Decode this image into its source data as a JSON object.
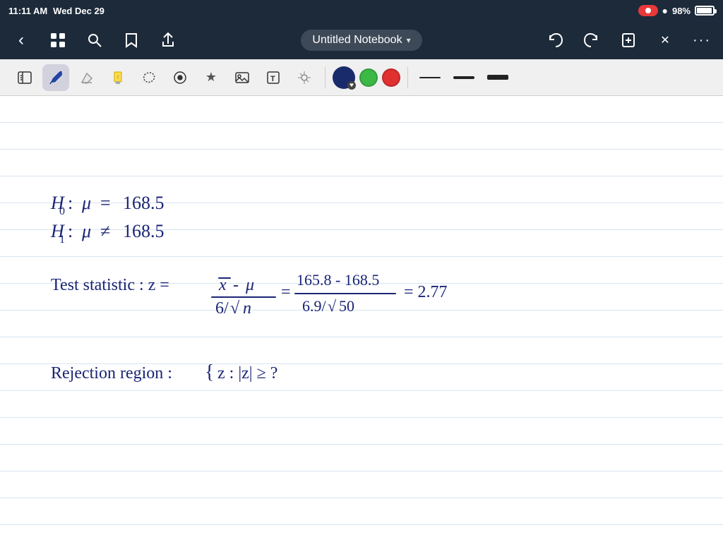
{
  "status_bar": {
    "time": "11:11 AM",
    "date": "Wed Dec 29",
    "battery_percent": "98%",
    "wifi": true,
    "recording": true
  },
  "nav_bar": {
    "back_label": "‹",
    "apps_icon": "⊞",
    "search_icon": "⌕",
    "bookmark_icon": "🔖",
    "share_icon": "↑",
    "title": "Untitled Notebook",
    "title_chevron": "▾",
    "undo_icon": "↩",
    "redo_icon": "↪",
    "add_page_icon": "☐",
    "close_icon": "✕",
    "more_icon": "···"
  },
  "toolbar": {
    "panel_icon": "▤",
    "pen_icon": "✏",
    "eraser_icon": "⬜",
    "highlighter_icon": "✒",
    "lasso_icon": "◎",
    "shape_icon": "◯",
    "star_icon": "★",
    "image_icon": "🖼",
    "text_icon": "T",
    "laser_icon": "✦",
    "colors": [
      {
        "name": "navy",
        "hex": "#1a2b6b",
        "active": true
      },
      {
        "name": "green",
        "hex": "#3cb846"
      },
      {
        "name": "red",
        "hex": "#e03030"
      }
    ],
    "strokes": [
      {
        "name": "thin",
        "height": 2
      },
      {
        "name": "medium",
        "height": 4
      },
      {
        "name": "thick",
        "height": 7
      }
    ]
  },
  "notebook": {
    "title": "Untitled Notebook",
    "content_lines": [
      "H₀: μ = 168.5",
      "H₁: μ ≠ 168.5",
      "Test statistic: z = (x̄ - μ) / (6/√n) = (165.8 - 168.5) / (6.9/√50) = 2.77",
      "Rejection region: { z: |z| ≥ ?"
    ]
  }
}
